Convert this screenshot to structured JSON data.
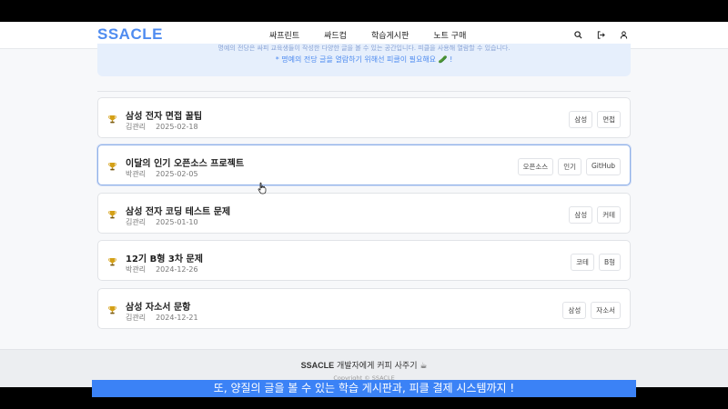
{
  "header": {
    "logo": "SSACLE",
    "menu": [
      "싸프린트",
      "싸드컵",
      "학습게시판",
      "노트 구매"
    ],
    "icons": [
      "search-icon",
      "logout-icon",
      "user-icon"
    ]
  },
  "notice": {
    "top_line": "명예의 전당은 싸피 교육생들이 작성한 다양한 글을 볼 수 있는 공간입니다. 피클을 사용해 열람할 수 있습니다.",
    "line": "* 명예의 전당 글을 열람하기 위해선 피클이 필요해요 🥒 !"
  },
  "posts": [
    {
      "title": "삼성 전자 면접 꿀팁",
      "author": "김관리",
      "date": "2025-02-18",
      "tags": [
        "삼성",
        "면접"
      ]
    },
    {
      "title": "이달의 인기 오픈소스 프로젝트",
      "author": "박관리",
      "date": "2025-02-05",
      "tags": [
        "오픈소스",
        "인기",
        "GitHub"
      ]
    },
    {
      "title": "삼성 전자 코딩 테스트 문제",
      "author": "김관리",
      "date": "2025-01-10",
      "tags": [
        "삼성",
        "커테"
      ]
    },
    {
      "title": "12기 B형 3차 문제",
      "author": "박관리",
      "date": "2024-12-26",
      "tags": [
        "코테",
        "B형"
      ]
    },
    {
      "title": "삼성 자소서 문항",
      "author": "김관리",
      "date": "2024-12-21",
      "tags": [
        "삼성",
        "자소서"
      ]
    }
  ],
  "footer": {
    "brand": "SSACLE",
    "text": " 개발자에게 커피 사주기 ☕",
    "copyright": "Copyright © SSACLE"
  },
  "caption": "또, 양질의 글을 볼 수 있는 학습 게시판과, 피클 결제 시스템까지 !",
  "colors": {
    "accent": "#4f8cf0",
    "caption_bg": "#3b82f6"
  }
}
